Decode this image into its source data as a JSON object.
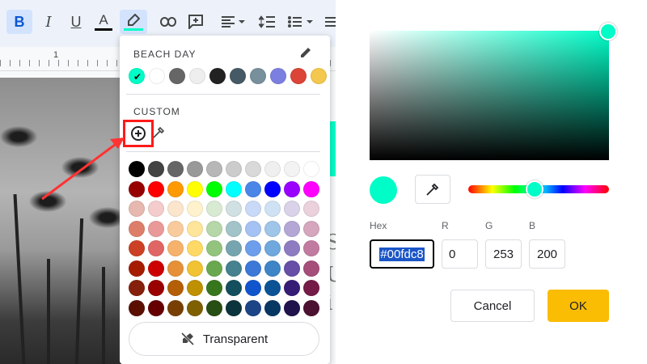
{
  "toolbar": {
    "bold": "B",
    "italic": "I",
    "underline": "U",
    "text_color": "A"
  },
  "ruler": {
    "marker": "1"
  },
  "doc_glyphs": [
    "S",
    "U",
    "i"
  ],
  "color_menu": {
    "theme_title": "BEACH DAY",
    "theme_colors": [
      "#00fdc8",
      "#ffffff",
      "#666666",
      "#eeeeee",
      "#222222",
      "#455a64",
      "#78909c",
      "#7b7fe0",
      "#db4437",
      "#f4c84d"
    ],
    "selected_theme_color": "#00fdc8",
    "custom_title": "CUSTOM",
    "transparent_label": "Transparent",
    "standard_colors": [
      [
        "#000000",
        "#434343",
        "#666666",
        "#999999",
        "#b7b7b7",
        "#cccccc",
        "#d9d9d9",
        "#efefef",
        "#f3f3f3",
        "#ffffff"
      ],
      [
        "#980000",
        "#ff0000",
        "#ff9900",
        "#ffff00",
        "#00ff00",
        "#00ffff",
        "#4a86e8",
        "#0000ff",
        "#9900ff",
        "#ff00ff"
      ],
      [
        "#e6b8af",
        "#f4cccc",
        "#fce5cd",
        "#fff2cc",
        "#d9ead3",
        "#d0e0e3",
        "#c9daf8",
        "#cfe2f3",
        "#d9d2e9",
        "#ead1dc"
      ],
      [
        "#dd7e6b",
        "#ea9999",
        "#f9cb9c",
        "#ffe599",
        "#b6d7a8",
        "#a2c4c9",
        "#a4c2f4",
        "#9fc5e8",
        "#b4a7d6",
        "#d5a6bd"
      ],
      [
        "#cc4125",
        "#e06666",
        "#f6b26b",
        "#ffd966",
        "#93c47d",
        "#76a5af",
        "#6d9eeb",
        "#6fa8dc",
        "#8e7cc3",
        "#c27ba0"
      ],
      [
        "#a61c00",
        "#cc0000",
        "#e69138",
        "#f1c232",
        "#6aa84f",
        "#45818e",
        "#3c78d8",
        "#3d85c6",
        "#674ea7",
        "#a64d79"
      ],
      [
        "#85200c",
        "#990000",
        "#b45f06",
        "#bf9000",
        "#38761d",
        "#134f5c",
        "#1155cc",
        "#0b5394",
        "#351c75",
        "#741b47"
      ],
      [
        "#5b0f00",
        "#660000",
        "#783f04",
        "#7f6000",
        "#274e13",
        "#0c343d",
        "#1c4587",
        "#073763",
        "#20124d",
        "#4c1130"
      ]
    ]
  },
  "picker": {
    "current_color": "#00fdc8",
    "hex_label": "Hex",
    "r_label": "R",
    "g_label": "G",
    "b_label": "B",
    "hex_value": "#00fdc8",
    "r_value": "0",
    "g_value": "253",
    "b_value": "200",
    "cancel_label": "Cancel",
    "ok_label": "OK"
  }
}
